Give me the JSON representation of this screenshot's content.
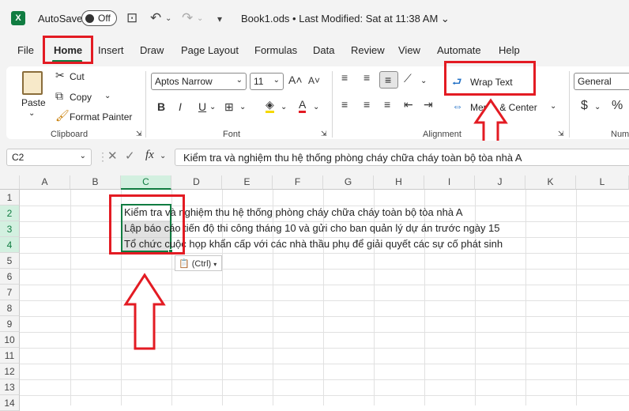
{
  "titlebar": {
    "autosave_label": "AutoSave",
    "autosave_state": "Off",
    "doc_title": "Book1.ods • Last Modified: Sat at 11:38 AM ⌄"
  },
  "menu": {
    "tabs": [
      "File",
      "Home",
      "Insert",
      "Draw",
      "Page Layout",
      "Formulas",
      "Data",
      "Review",
      "View",
      "Automate",
      "Help"
    ],
    "active": "Home"
  },
  "ribbon": {
    "clipboard": {
      "paste": "Paste",
      "cut": "Cut",
      "copy": "Copy",
      "format_painter": "Format Painter",
      "label": "Clipboard"
    },
    "font": {
      "name": "Aptos Narrow",
      "size": "11",
      "bold": "B",
      "italic": "I",
      "underline": "U",
      "label": "Font"
    },
    "alignment": {
      "wrap_text": "Wrap Text",
      "merge_center": "Merge & Center",
      "label": "Alignment"
    },
    "number": {
      "format": "General",
      "currency": "$",
      "percent": "%",
      "label": "Num"
    }
  },
  "formula_bar": {
    "name_box": "C2",
    "fx": "fx",
    "content": "Kiểm tra và nghiệm thu hệ thống phòng cháy chữa cháy toàn bộ tòa nhà A"
  },
  "sheet": {
    "columns": [
      "A",
      "B",
      "C",
      "D",
      "E",
      "F",
      "G",
      "H",
      "I",
      "J",
      "K",
      "L"
    ],
    "selected_column": "C",
    "rows": [
      "1",
      "2",
      "3",
      "4",
      "5",
      "6",
      "7",
      "8",
      "9",
      "10",
      "11",
      "12",
      "13",
      "14"
    ],
    "cells": {
      "C2": "Kiểm tra và nghiệm thu hệ thống phòng cháy chữa cháy toàn bộ tòa nhà A",
      "C3": "Lập báo cáo tiến độ thi công tháng 10 và gửi cho ban quản lý dự án trước ngày 15",
      "C4": "Tổ chức cuộc họp khẩn cấp với các nhà thầu phụ để giải quyết các sự cố phát sinh"
    },
    "paste_options": "(Ctrl)"
  },
  "colors": {
    "accent": "#107c41",
    "annotation": "#e31b23"
  }
}
